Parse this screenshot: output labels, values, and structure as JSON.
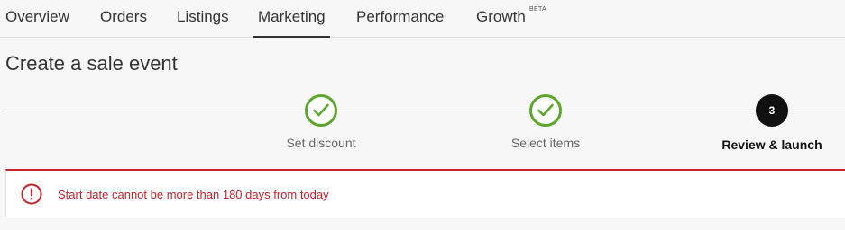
{
  "nav": {
    "tabs": [
      {
        "label": "Overview"
      },
      {
        "label": "Orders"
      },
      {
        "label": "Listings"
      },
      {
        "label": "Marketing",
        "active": true
      },
      {
        "label": "Performance"
      },
      {
        "label": "Growth",
        "badge": "BETA"
      }
    ]
  },
  "page": {
    "title": "Create a sale event"
  },
  "stepper": {
    "steps": [
      {
        "label": "Set discount",
        "status": "complete",
        "icon": "check-icon"
      },
      {
        "label": "Select items",
        "status": "complete",
        "icon": "check-icon"
      },
      {
        "label": "Review & launch",
        "status": "current",
        "number": "3"
      }
    ],
    "colors": {
      "complete": "#5ba72b",
      "current": "#111111",
      "line": "#999999"
    }
  },
  "alert": {
    "type": "error",
    "icon": "alert-circle-icon",
    "message": "Start date cannot be more than 180 days from today",
    "color": "#c7232b"
  }
}
